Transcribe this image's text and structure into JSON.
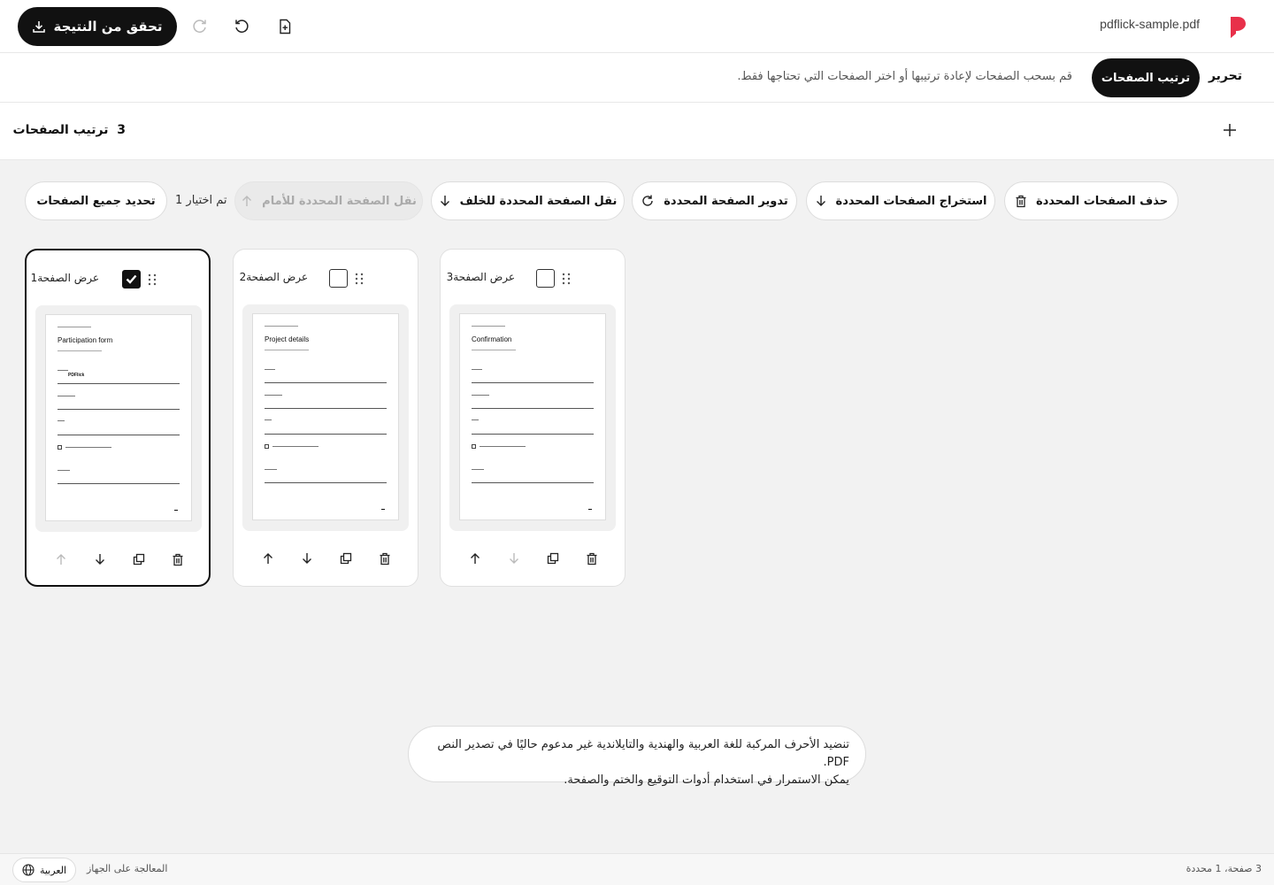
{
  "header": {
    "filename": "pdflick-sample.pdf",
    "export_label": "تحقق من النتيجة",
    "brand_color": "#e8304a"
  },
  "tabs": {
    "edit": "تحرير",
    "reorder": "ترتيب الصفحات",
    "description": "قم بسحب الصفحات لإعادة ترتيبها أو اختر الصفحات التي تحتاجها فقط."
  },
  "section": {
    "count": "3",
    "title": "ترتيب الصفحات"
  },
  "toolbar": {
    "select_all": "تحديد جميع الصفحات",
    "selected_count": "تم اختيار 1",
    "move_forward": "نقل الصفحة المحددة للأمام",
    "move_back": "نقل الصفحة المحددة للخلف",
    "rotate": "تدوير الصفحة المحددة",
    "extract": "استخراج الصفحات المحددة",
    "delete": "حذف الصفحات المحددة"
  },
  "pages": [
    {
      "label": "عرض الصفحة1",
      "selected": true,
      "thumb_title": "Participation form",
      "thumb_value": "PDFlick",
      "can_move_up": false,
      "can_move_down": true
    },
    {
      "label": "عرض الصفحة2",
      "selected": false,
      "thumb_title": "Project details",
      "can_move_up": true,
      "can_move_down": true
    },
    {
      "label": "عرض الصفحة3",
      "selected": false,
      "thumb_title": "Confirmation",
      "can_move_up": true,
      "can_move_down": false
    }
  ],
  "notice": {
    "line1": "تنضيد الأحرف المركبة للغة العربية والهندية والتايلاندية غير مدعوم حاليًا في تصدير النص PDF.",
    "line2": "يمكن الاستمرار في استخدام أدوات التوقيع والختم والصفحة."
  },
  "footer": {
    "page_status": "3 صفحة، 1 محددة",
    "processing": "المعالجة على الجهاز",
    "language": "العربية"
  }
}
